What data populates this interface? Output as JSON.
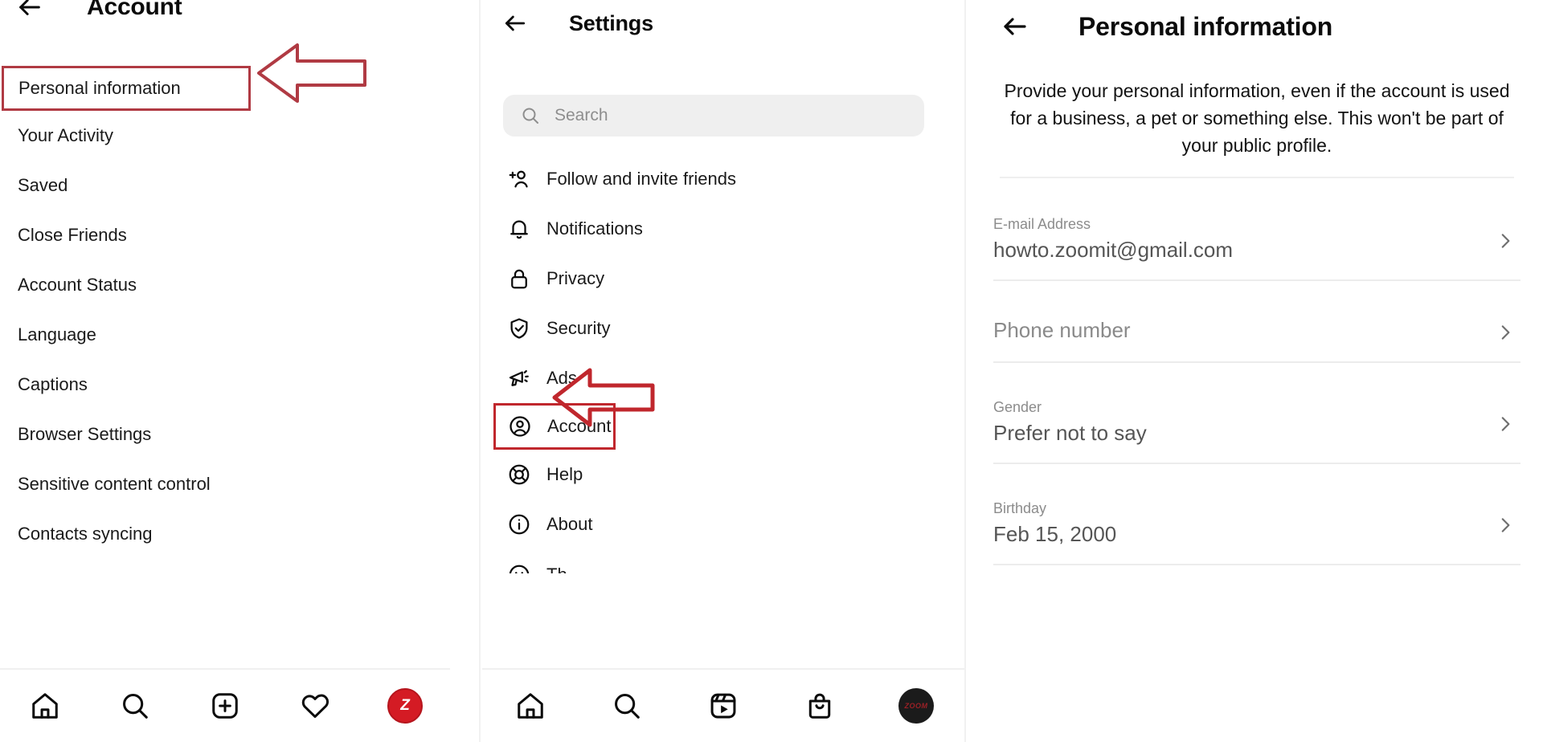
{
  "panels": {
    "account": {
      "header": {
        "title": "Account",
        "back_icon": "arrow-left-icon"
      },
      "items": [
        {
          "label": "Personal information",
          "highlighted": true
        },
        {
          "label": "Your Activity",
          "highlighted": false
        },
        {
          "label": "Saved",
          "highlighted": false
        },
        {
          "label": "Close Friends",
          "highlighted": false
        },
        {
          "label": "Account Status",
          "highlighted": false
        },
        {
          "label": "Language",
          "highlighted": false
        },
        {
          "label": "Captions",
          "highlighted": false
        },
        {
          "label": "Browser Settings",
          "highlighted": false
        },
        {
          "label": "Sensitive content control",
          "highlighted": false
        },
        {
          "label": "Contacts syncing",
          "highlighted": false
        }
      ],
      "bottom_nav": [
        {
          "name": "home-icon",
          "label": "Home"
        },
        {
          "name": "search-icon",
          "label": "Search"
        },
        {
          "name": "add-post-icon",
          "label": "Create"
        },
        {
          "name": "heart-icon",
          "label": "Activity"
        },
        {
          "name": "profile-avatar",
          "label": "Z"
        }
      ]
    },
    "settings": {
      "header": {
        "title": "Settings",
        "back_icon": "arrow-left-icon"
      },
      "search": {
        "placeholder": "Search",
        "value": "",
        "icon": "search-icon"
      },
      "items": [
        {
          "label": "Follow and invite friends",
          "icon": "add-person-icon",
          "highlighted": false
        },
        {
          "label": "Notifications",
          "icon": "bell-icon",
          "highlighted": false
        },
        {
          "label": "Privacy",
          "icon": "lock-icon",
          "highlighted": false
        },
        {
          "label": "Security",
          "icon": "shield-check-icon",
          "highlighted": false
        },
        {
          "label": "Ads",
          "icon": "megaphone-icon",
          "highlighted": false
        },
        {
          "label": "Account",
          "icon": "account-circle-icon",
          "highlighted": true
        },
        {
          "label": "Help",
          "icon": "lifebuoy-icon",
          "highlighted": false
        },
        {
          "label": "About",
          "icon": "info-circle-icon",
          "highlighted": false
        },
        {
          "label": "Th",
          "icon": "theme-icon",
          "highlighted": false
        }
      ],
      "bottom_nav": [
        {
          "name": "home-icon",
          "label": "Home"
        },
        {
          "name": "search-icon",
          "label": "Search"
        },
        {
          "name": "reels-icon",
          "label": "Reels"
        },
        {
          "name": "shop-icon",
          "label": "Shop"
        },
        {
          "name": "profile-avatar",
          "label": "ZOOM"
        }
      ]
    },
    "personal": {
      "header": {
        "title": "Personal information",
        "back_icon": "arrow-left-icon"
      },
      "description": "Provide your personal information, even if the account is used for a business, a pet or something else. This won't be part of your public profile.",
      "fields": [
        {
          "label": "E-mail Address",
          "value": "howto.zoomit@gmail.com",
          "has_label": true
        },
        {
          "label": "",
          "value": "Phone number",
          "has_label": false
        },
        {
          "label": "Gender",
          "value": "Prefer not to say",
          "has_label": true
        },
        {
          "label": "Birthday",
          "value": "Feb 15, 2000",
          "has_label": true
        }
      ],
      "chevron_icon": "chevron-right-icon"
    }
  },
  "annotations": {
    "arrow_one": {
      "name": "callout-arrow-personal-information",
      "points_to": "Personal information"
    },
    "arrow_two": {
      "name": "callout-arrow-account",
      "points_to": "Account"
    }
  },
  "colors": {
    "highlight_box_1": "#b03a43",
    "highlight_box_2": "#c0272d",
    "arrow_stroke": "#c0272d",
    "avatar_red": "#d41b24",
    "text_primary": "#1a1a1a",
    "text_muted": "#8c8c8c",
    "search_bg": "#efefef",
    "divider": "#ececec"
  }
}
